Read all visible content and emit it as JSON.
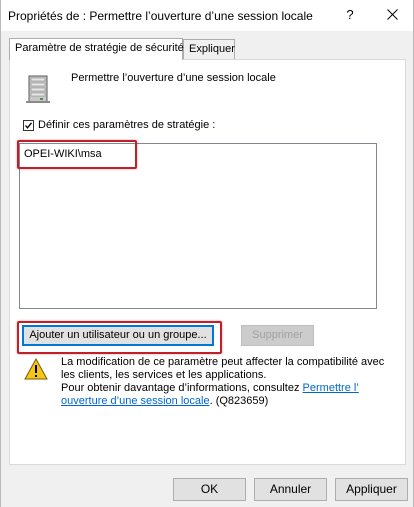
{
  "window": {
    "title": "Propriétés de : Permettre l’ouverture d’une session locale",
    "help_label": "?"
  },
  "tabs": [
    {
      "label": "Paramètre de stratégie de sécurité",
      "active": true
    },
    {
      "label": "Expliquer",
      "active": false
    }
  ],
  "policy": {
    "icon": "server-policy-icon",
    "name": "Permettre l’ouverture d’une session locale"
  },
  "define_settings": {
    "label": "Définir ces paramètres de stratégie :",
    "checked": true
  },
  "members": [
    "OPEI-WIKI\\msa"
  ],
  "buttons": {
    "add": "Ajouter un utilisateur ou un groupe...",
    "remove": "Supprimer",
    "ok": "OK",
    "cancel": "Annuler",
    "apply": "Appliquer"
  },
  "warning": {
    "icon": "warning-icon",
    "line1": "La modification de ce paramètre peut affecter la compatibilité avec",
    "line2": "les clients, les services et les applications.",
    "line3_prefix": "Pour obtenir davantage d’informations, consultez ",
    "link_part1": "Permettre l’",
    "link_part2": "ouverture d’une session locale",
    "line4_suffix": ". (Q823659)"
  },
  "colors": {
    "highlight": "#c0202a",
    "link": "#0066cc",
    "focus": "#0078d7"
  }
}
